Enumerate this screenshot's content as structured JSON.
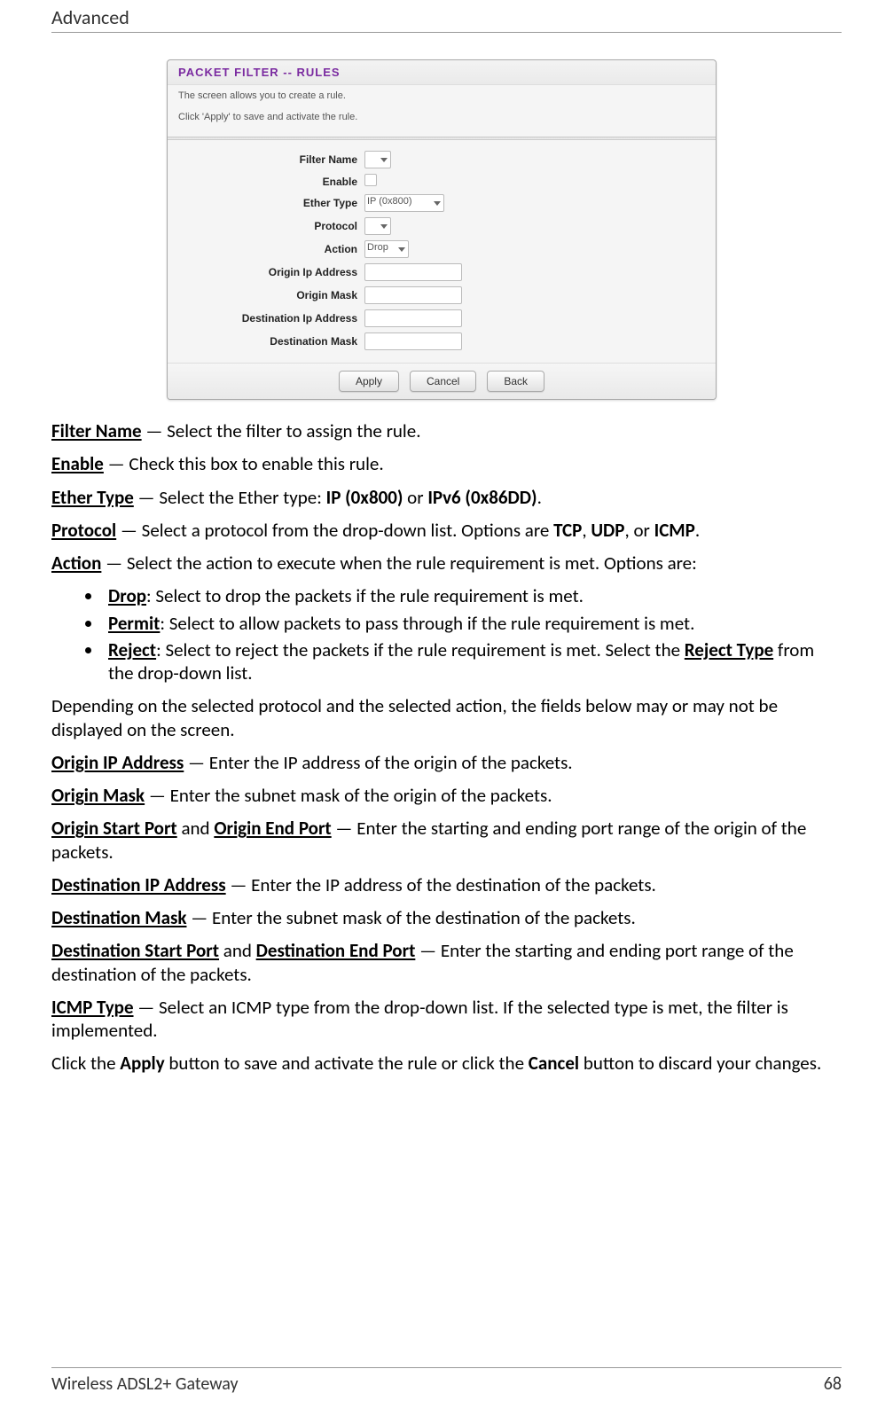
{
  "header": "Advanced",
  "panel": {
    "title": "PACKET FILTER -- RULES",
    "desc1": "The screen allows you to create a rule.",
    "desc2": "Click 'Apply' to save and activate the rule.",
    "fields": {
      "filter_name_label": "Filter Name",
      "filter_name_value": "",
      "enable_label": "Enable",
      "ether_type_label": "Ether Type",
      "ether_type_value": "IP (0x800)",
      "protocol_label": "Protocol",
      "protocol_value": "",
      "action_label": "Action",
      "action_value": "Drop",
      "origin_ip_label": "Origin Ip Address",
      "origin_ip_value": "",
      "origin_mask_label": "Origin Mask",
      "origin_mask_value": "",
      "dest_ip_label": "Destination Ip Address",
      "dest_ip_value": "",
      "dest_mask_label": "Destination Mask",
      "dest_mask_value": ""
    },
    "buttons": {
      "apply": "Apply",
      "cancel": "Cancel",
      "back": "Back"
    }
  },
  "doc": {
    "p1": {
      "b": "Filter Name",
      "rest": " — Select the filter to assign the rule."
    },
    "p2": {
      "b": "Enable",
      "rest": " — Check this box to enable this rule."
    },
    "p3": {
      "b": "Ether Type",
      "m1": " — Select the Ether type: ",
      "o1": "IP (0x800)",
      "m2": " or ",
      "o2": "IPv6 (0x86DD)",
      "end": "."
    },
    "p4": {
      "b": "Protocol",
      "m1": " — Select a protocol from the drop-down list. Options are ",
      "o1": "TCP",
      "c1": ", ",
      "o2": "UDP",
      "c2": ", or ",
      "o3": "ICMP",
      "end": "."
    },
    "p5": {
      "b": "Action",
      "rest": " — Select the action to execute when the rule requirement is met. Options are:"
    },
    "li1": {
      "b": "Drop",
      "rest": ": Select to drop the packets if the rule requirement is met."
    },
    "li2": {
      "b": "Permit",
      "rest": ": Select to allow packets to pass through if the rule requirement is met."
    },
    "li3": {
      "b": "Reject",
      "m1": ": Select to reject the packets if the rule requirement is met. Select the ",
      "u": "Reject Type",
      "m2": " from the drop-down list."
    },
    "p6": "Depending on the selected protocol and the selected action, the fields below may or may not be displayed on the screen.",
    "p7": {
      "b": "Origin IP Address",
      "rest": " — Enter the IP address of the origin of the packets."
    },
    "p8": {
      "b": "Origin Mask",
      "rest": " — Enter the subnet mask of the origin of the packets."
    },
    "p9": {
      "b1": "Origin Start Port",
      "m1": " and ",
      "b2": "Origin End Port",
      "rest": " — Enter the starting and ending port range of the origin of the packets."
    },
    "p10": {
      "b": "Destination IP Address",
      "rest": " — Enter the IP address of the destination of the packets."
    },
    "p11": {
      "b": "Destination Mask",
      "rest": " — Enter the subnet mask of the destination of the packets."
    },
    "p12": {
      "b1": "Destination Start Port",
      "m1": " and ",
      "b2": "Destination End Port",
      "rest": " — Enter the starting and ending port range of the destination of the packets."
    },
    "p13": {
      "b": "ICMP Type",
      "rest": " — Select an ICMP type from the drop-down list. If the selected type is met, the filter is implemented."
    },
    "p14": {
      "m1": "Click the ",
      "b1": "Apply",
      "m2": " button to save and activate the rule or click the ",
      "b2": "Cancel",
      "m3": " button to discard your changes."
    }
  },
  "footer": {
    "product": "Wireless ADSL2+ Gateway",
    "page": "68"
  }
}
